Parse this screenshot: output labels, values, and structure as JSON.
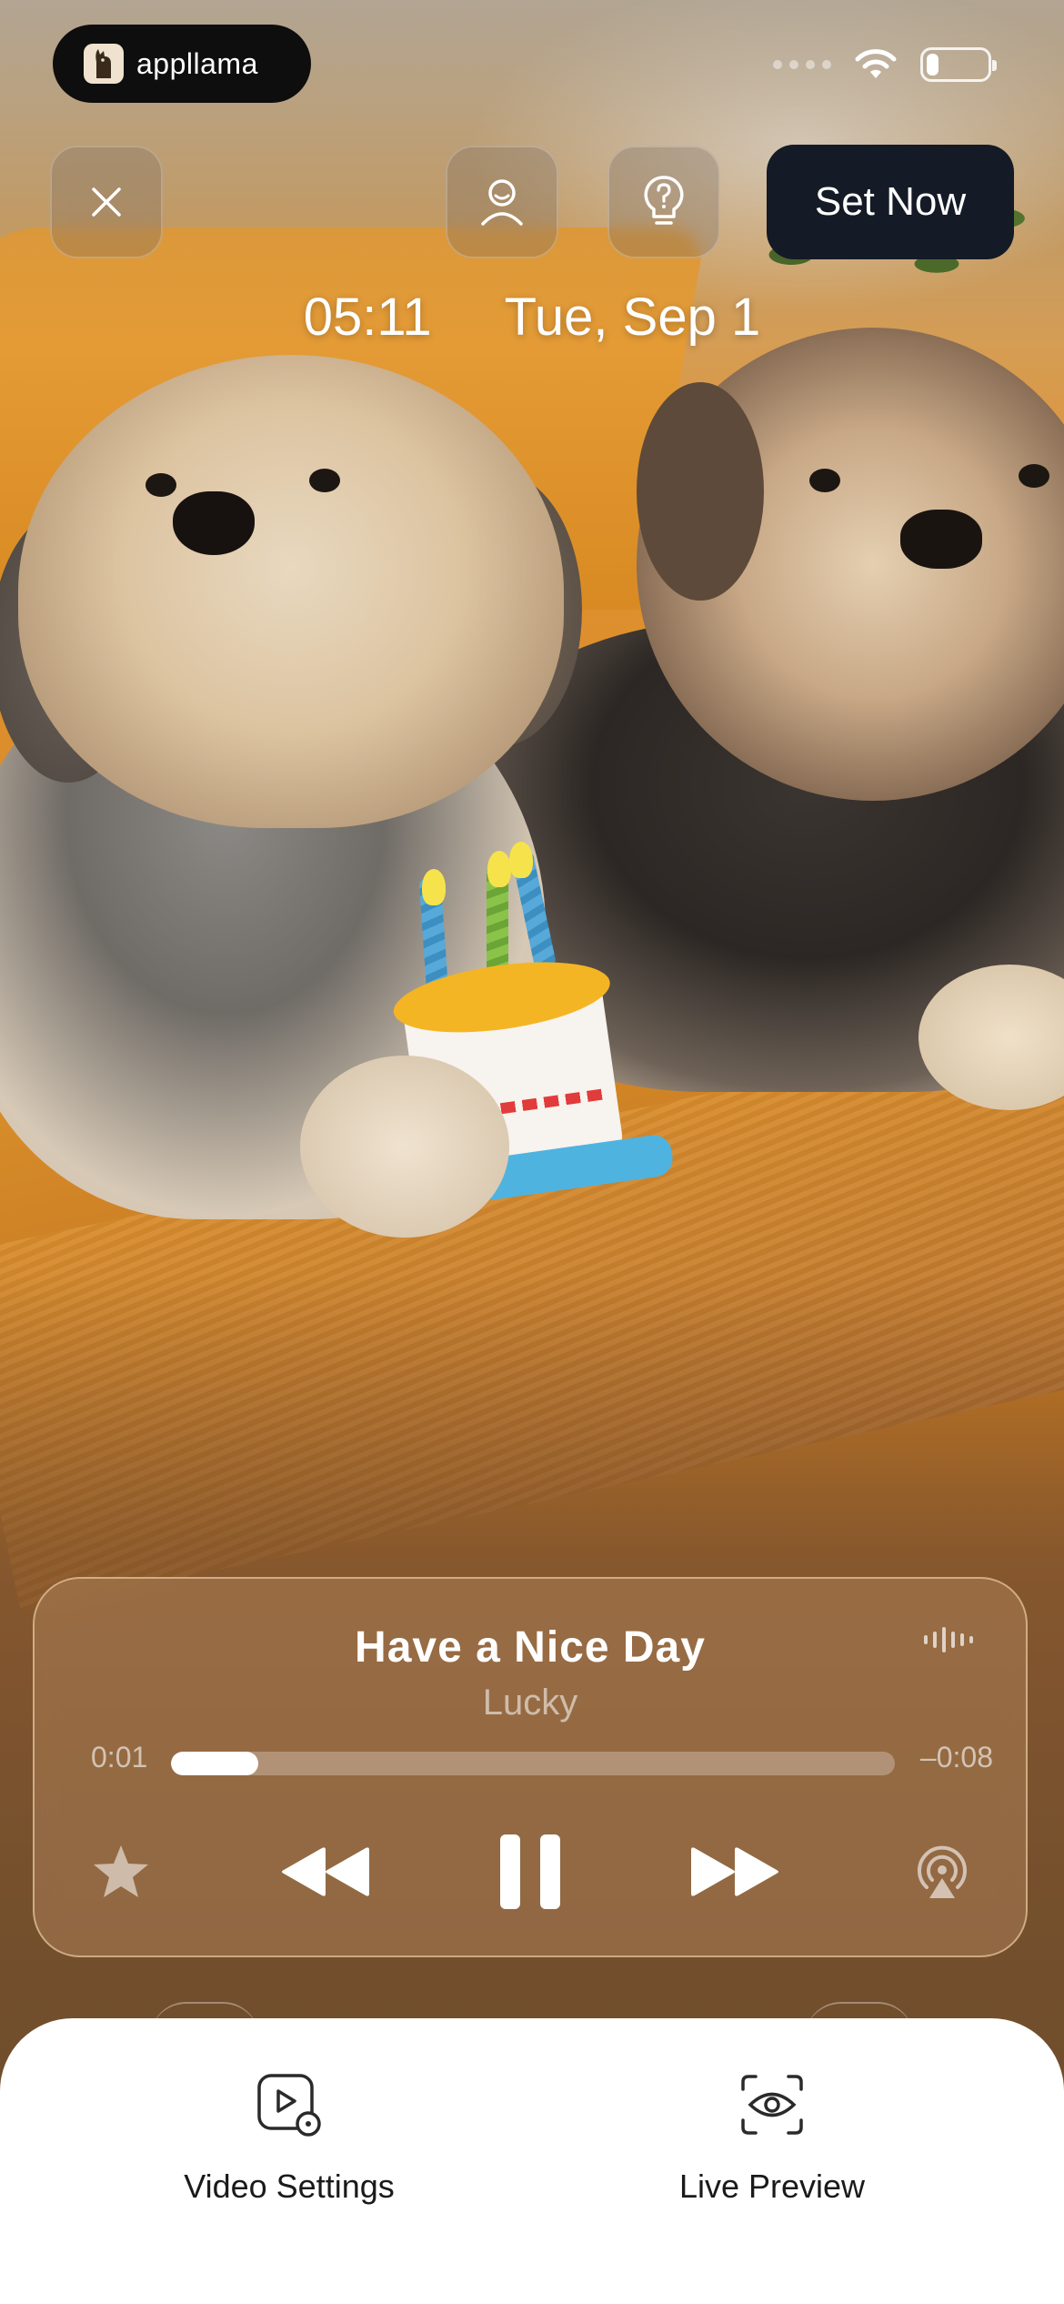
{
  "status_bar": {
    "brand_name": "appllama",
    "icons": [
      "signal-dots-icon",
      "wifi-icon",
      "battery-icon"
    ],
    "battery_level": 0.2
  },
  "top_controls": {
    "close_icon": "close-icon",
    "profile_icon": "profile-icon",
    "help_icon": "lightbulb-help-icon",
    "set_now_label": "Set Now"
  },
  "lock_screen": {
    "time": "05:11",
    "date": "Tue, Sep 1"
  },
  "player": {
    "title": "Have a Nice Day",
    "artist": "Lucky",
    "elapsed": "0:01",
    "remaining": "–0:08",
    "progress": 0.12,
    "controls": [
      "star-icon",
      "rewind-icon",
      "pause-icon",
      "fast-forward-icon",
      "airplay-icon"
    ],
    "waveform_icon": "waveform-icon"
  },
  "bottom_sheet": {
    "items": [
      {
        "label": "Video Settings",
        "icon": "video-settings-icon"
      },
      {
        "label": "Live Preview",
        "icon": "live-preview-icon"
      }
    ]
  },
  "colors": {
    "set_now_bg": "#141a26",
    "sheet_bg": "#ffffff",
    "accent_text": "#ffffff"
  }
}
